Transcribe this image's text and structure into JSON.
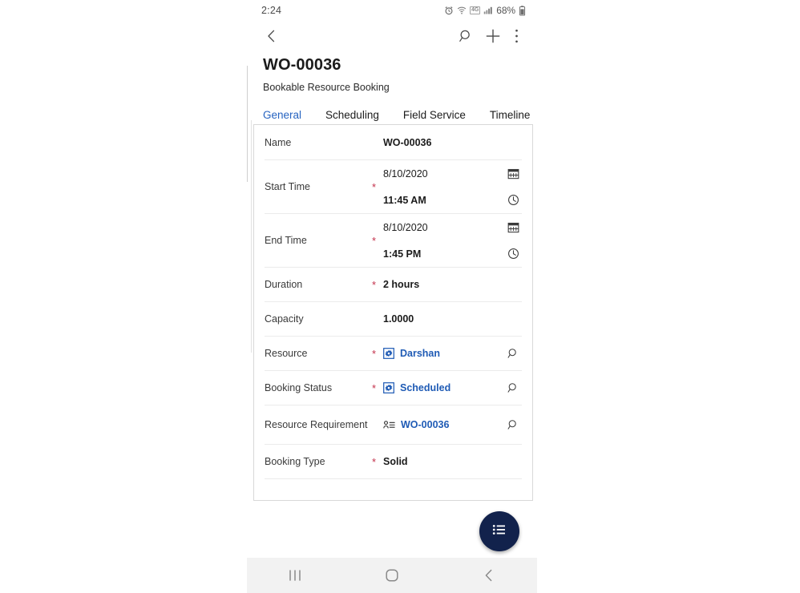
{
  "status_bar": {
    "time": "2:24",
    "network_label": "4G",
    "battery_percent": "68%",
    "icons": [
      "alarm-icon",
      "wifi-icon",
      "network-4g-icon",
      "signal-icon",
      "battery-icon"
    ]
  },
  "toolbar": {
    "back_label": "back-icon",
    "search_label": "search-icon",
    "add_label": "plus-icon",
    "more_label": "more-vertical-icon"
  },
  "header": {
    "title": "WO-00036",
    "subtitle": "Bookable Resource Booking"
  },
  "tabs": [
    {
      "label": "General",
      "active": true
    },
    {
      "label": "Scheduling",
      "active": false
    },
    {
      "label": "Field Service",
      "active": false
    },
    {
      "label": "Timeline",
      "active": false
    }
  ],
  "form": {
    "fields": [
      {
        "label": "Name",
        "required": false,
        "type": "text",
        "value": "WO-00036"
      },
      {
        "label": "Start Time",
        "required": true,
        "type": "datetime",
        "date": "8/10/2020",
        "time": "11:45 AM",
        "date_icon": "calendar-icon",
        "time_icon": "clock-icon"
      },
      {
        "label": "End Time",
        "required": true,
        "type": "datetime",
        "date": "8/10/2020",
        "time": "1:45 PM",
        "date_icon": "calendar-icon",
        "time_icon": "clock-icon"
      },
      {
        "label": "Duration",
        "required": true,
        "type": "text",
        "value": "2 hours"
      },
      {
        "label": "Capacity",
        "required": false,
        "type": "text",
        "value": "1.0000"
      },
      {
        "label": "Resource",
        "required": true,
        "type": "lookup",
        "value": "Darshan",
        "entity_icon": "resource-entity-icon",
        "action_icon": "lookup-search-icon"
      },
      {
        "label": "Booking Status",
        "required": true,
        "type": "lookup",
        "value": "Scheduled",
        "entity_icon": "booking-status-entity-icon",
        "action_icon": "lookup-search-icon"
      },
      {
        "label": "Resource Requirement",
        "required": false,
        "type": "lookup",
        "value": "WO-00036",
        "entity_icon": "requirement-entity-icon",
        "action_icon": "lookup-search-icon"
      },
      {
        "label": "Booking Type",
        "required": true,
        "type": "text",
        "value": "Solid"
      }
    ]
  },
  "fab": {
    "label": "command-list-button",
    "icon": "list-icon"
  },
  "android_nav": {
    "recents": "recents-icon",
    "home": "home-icon",
    "back": "back-icon"
  },
  "colors": {
    "accent": "#2663c0",
    "link": "#1f5bb5",
    "required": "#c4314b",
    "fab": "#12224c",
    "nav_bg": "#f2f2f2"
  }
}
